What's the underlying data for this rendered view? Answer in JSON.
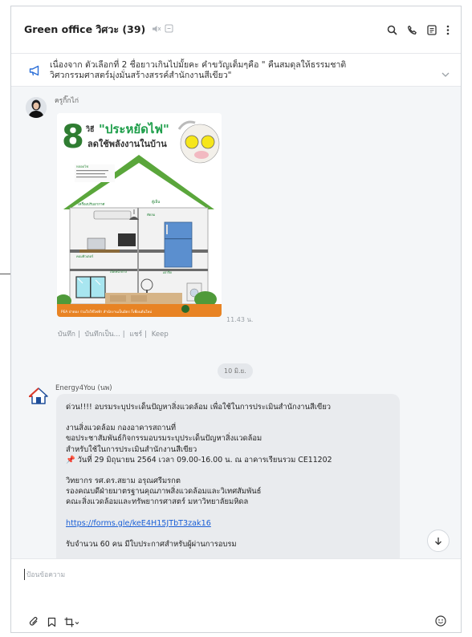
{
  "header": {
    "title": "Green office วิศวะ (39)",
    "mute_icon": "mute-icon",
    "tag_icon": "tag-icon"
  },
  "announcement": {
    "text": "เนื่องจาก ตัวเลือกที่ 2 ชื่อยาวเกินไปมั้ยคะ คำขวัญเต็มๆคือ \" คืนสมดุลให้ธรรมชาติ วิศวกรรมศาสตร์มุ่งมั่นสร้างสรรค์สำนักงานสีเขียว\""
  },
  "message1": {
    "sender": "ครูกิ๊กไก่",
    "time": "11.43 น.",
    "poster_title_num": "8",
    "poster_title_word": "วิธี",
    "poster_title_main": "\"ประหยัดไฟ\"",
    "poster_subtitle": "ลดใช้พลังงานในบ้าน",
    "poster_footer": "PEA ป่าตอง ร่วมใจใช้ไฟฟ้า สำนักงานเป็นมิตร ก็เพื่อนต้นใหม่",
    "actions": [
      "บันทึก",
      "บันทึกเป็น...",
      "แชร์",
      "Keep"
    ]
  },
  "date_separator": "10 มิ.ย.",
  "message2": {
    "sender": "Energy4You (นพ)",
    "lines": [
      "ด่วน!!!! อบรมระบุประเด็นปัญหาสิ่งแวดล้อม เพื่อใช้ในการประเมินสำนักงานสีเขียว",
      "",
      "งานสิ่งแวดล้อม กองอาคารสถานที่",
      "ขอประชาสัมพันธ์กิจกรรมอบรมระบุประเด็นปัญหาสิ่งแวดล้อม",
      "สำหรับใช้ในการประเมินสำนักงานสีเขียว",
      "วันที่ 29 มิถุนายน 2564 เวลา 09.00-16.00 น. ณ อาคารเรียนรวม CE11202",
      "",
      "วิทยากร รศ.ดร.สยาม อรุณศรีมรกต",
      "รองคณบดีฝ่ายมาตรฐานคุณภาพสิ่งแวดล้อมและวิเทศสัมพันธ์",
      "คณะสิ่งแวดล้อมและทรัพยากรศาสตร์ มหาวิทยาลัยมหิดล",
      "",
      "https://forms.gle/keE4H15JTbT3zak16",
      "",
      "รับจำนวน 60 คน มีใบประกาศสำหรับผู้ผ่านการอบรม"
    ]
  },
  "composer": {
    "placeholder": "ป้อนข้อความ"
  },
  "colors": {
    "accent": "#1a5fd6",
    "bubble": "#e9ebee",
    "chat_bg": "#f4f6f8"
  }
}
